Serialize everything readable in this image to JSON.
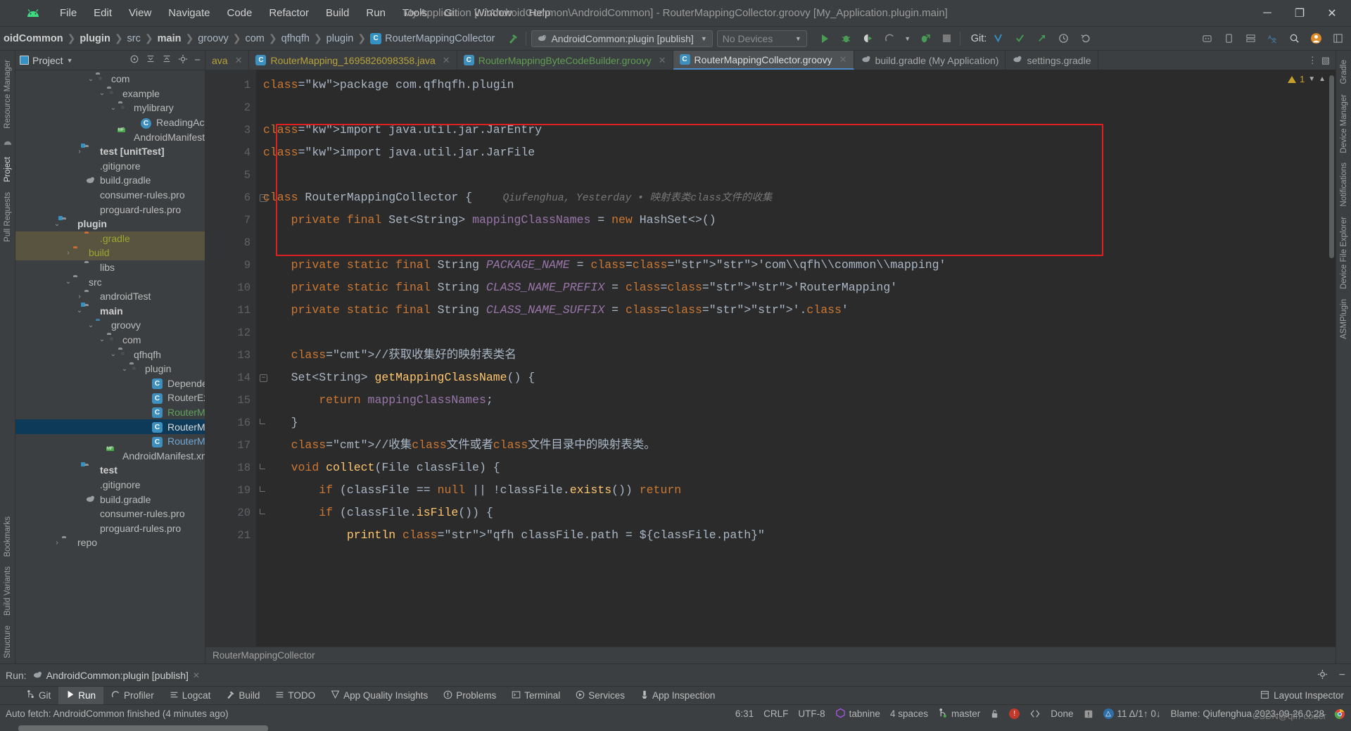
{
  "window": {
    "title": "My Application [...\\AndroidCommon\\AndroidCommon] - RouterMappingCollector.groovy [My_Application.plugin.main]",
    "minimize": "─",
    "maximize": "❐",
    "close": "✕"
  },
  "menu": [
    "File",
    "Edit",
    "View",
    "Navigate",
    "Code",
    "Refactor",
    "Build",
    "Run",
    "Tools",
    "Git",
    "Window",
    "Help"
  ],
  "breadcrumbs": [
    {
      "label": "oidCommon",
      "bold": true,
      "icon": null
    },
    {
      "label": "plugin",
      "bold": true,
      "icon": null
    },
    {
      "label": "src",
      "bold": false,
      "icon": null
    },
    {
      "label": "main",
      "bold": true,
      "icon": null
    },
    {
      "label": "groovy",
      "bold": false,
      "icon": null
    },
    {
      "label": "com",
      "bold": false,
      "icon": null
    },
    {
      "label": "qfhqfh",
      "bold": false,
      "icon": null
    },
    {
      "label": "plugin",
      "bold": false,
      "icon": null
    },
    {
      "label": "RouterMappingCollector",
      "bold": false,
      "icon": "C"
    }
  ],
  "toolbar": {
    "run_config": "AndroidCommon:plugin [publish]",
    "device": "No Devices",
    "git_label": "Git:",
    "icons": [
      "build-hammer-icon",
      "run-icon",
      "debug-icon",
      "run-coverage-icon",
      "profiler-icon",
      "attach-debugger-icon",
      "stop-icon",
      "git-update-icon",
      "git-commit-icon",
      "git-push-icon",
      "history-icon",
      "undo-icon"
    ],
    "right_icons": [
      "search-everywhere-icon",
      "settings-icon",
      "layout-icon",
      "translate-icon",
      "avatar-icon"
    ]
  },
  "project_panel": {
    "title": "Project",
    "header_icons": [
      "target-icon",
      "collapse-all-icon",
      "expand-all-icon",
      "gear-icon",
      "hide-icon"
    ],
    "tree": [
      {
        "label": "com",
        "indent": 6,
        "arrow": "down",
        "icon": "folder-pkg",
        "style": ""
      },
      {
        "label": "example",
        "indent": 7,
        "arrow": "down",
        "icon": "folder-pkg",
        "style": ""
      },
      {
        "label": "mylibrary",
        "indent": 8,
        "arrow": "down",
        "icon": "folder-pkg",
        "style": ""
      },
      {
        "label": "ReadingActiv",
        "indent": 10,
        "arrow": "",
        "icon": "kotlin-class",
        "style": ""
      },
      {
        "label": "AndroidManifest.xml",
        "indent": 8,
        "arrow": "",
        "icon": "manifest",
        "style": ""
      },
      {
        "label": "test [unitTest]",
        "indent": 5,
        "arrow": "right",
        "icon": "folder-src",
        "style": "bold"
      },
      {
        "label": ".gitignore",
        "indent": 5,
        "arrow": "",
        "icon": "gitignore",
        "style": ""
      },
      {
        "label": "build.gradle",
        "indent": 5,
        "arrow": "",
        "icon": "gradle",
        "style": ""
      },
      {
        "label": "consumer-rules.pro",
        "indent": 5,
        "arrow": "",
        "icon": "file",
        "style": ""
      },
      {
        "label": "proguard-rules.pro",
        "indent": 5,
        "arrow": "",
        "icon": "file",
        "style": ""
      },
      {
        "label": "plugin",
        "indent": 3,
        "arrow": "down",
        "icon": "folder-src",
        "style": "bold"
      },
      {
        "label": ".gradle",
        "indent": 5,
        "arrow": "",
        "icon": "folder-orange",
        "style": "olive",
        "highlight": "tan"
      },
      {
        "label": "build",
        "indent": 4,
        "arrow": "right",
        "icon": "folder-orange",
        "style": "olive",
        "highlight": "tan"
      },
      {
        "label": "libs",
        "indent": 5,
        "arrow": "",
        "icon": "folder",
        "style": ""
      },
      {
        "label": "src",
        "indent": 4,
        "arrow": "down",
        "icon": "folder",
        "style": ""
      },
      {
        "label": "androidTest",
        "indent": 5,
        "arrow": "right",
        "icon": "folder",
        "style": ""
      },
      {
        "label": "main",
        "indent": 5,
        "arrow": "down",
        "icon": "folder-src",
        "style": "bold"
      },
      {
        "label": "groovy",
        "indent": 6,
        "arrow": "down",
        "icon": "folder-blue",
        "style": ""
      },
      {
        "label": "com",
        "indent": 7,
        "arrow": "down",
        "icon": "folder-pkg",
        "style": ""
      },
      {
        "label": "qfhqfh",
        "indent": 8,
        "arrow": "down",
        "icon": "folder-pkg",
        "style": ""
      },
      {
        "label": "plugin",
        "indent": 9,
        "arrow": "down",
        "icon": "folder-pkg",
        "style": ""
      },
      {
        "label": "Dependencie",
        "indent": 11,
        "arrow": "",
        "icon": "class",
        "style": ""
      },
      {
        "label": "RouterExtens",
        "indent": 11,
        "arrow": "",
        "icon": "class",
        "style": ""
      },
      {
        "label": "RouterMappi",
        "indent": 11,
        "arrow": "",
        "icon": "class",
        "style": "green"
      },
      {
        "label": "RouterMapp",
        "indent": 11,
        "arrow": "",
        "icon": "class",
        "style": "white",
        "highlight": "sel"
      },
      {
        "label": "RouterMappi",
        "indent": 11,
        "arrow": "",
        "icon": "class",
        "style": "blue"
      },
      {
        "label": "AndroidManifest.xml",
        "indent": 7,
        "arrow": "",
        "icon": "manifest",
        "style": ""
      },
      {
        "label": "test",
        "indent": 5,
        "arrow": "",
        "icon": "folder-src",
        "style": "bold"
      },
      {
        "label": ".gitignore",
        "indent": 5,
        "arrow": "",
        "icon": "gitignore",
        "style": ""
      },
      {
        "label": "build.gradle",
        "indent": 5,
        "arrow": "",
        "icon": "gradle",
        "style": ""
      },
      {
        "label": "consumer-rules.pro",
        "indent": 5,
        "arrow": "",
        "icon": "file",
        "style": ""
      },
      {
        "label": "proguard-rules.pro",
        "indent": 5,
        "arrow": "",
        "icon": "file",
        "style": ""
      },
      {
        "label": "repo",
        "indent": 3,
        "arrow": "right",
        "icon": "folder",
        "style": ""
      }
    ]
  },
  "left_strip": [
    "Resource Manager",
    "Project",
    "Pull Requests"
  ],
  "left_strip_bottom": [
    "Bookmarks",
    "Build Variants",
    "Structure"
  ],
  "right_strip": [
    "Gradle",
    "Device Manager",
    "Notifications",
    "Device File Explorer",
    "ASMPlugin"
  ],
  "editor_tabs": [
    {
      "label": "ava",
      "icon": "",
      "color": "yellow",
      "active": false,
      "closable": true
    },
    {
      "label": "RouterMapping_1695826098358.java",
      "icon": "C",
      "color": "yellow",
      "active": false,
      "closable": true
    },
    {
      "label": "RouterMappingByteCodeBuilder.groovy",
      "icon": "C",
      "color": "green",
      "active": false,
      "closable": true
    },
    {
      "label": "RouterMappingCollector.groovy",
      "icon": "C",
      "color": "white",
      "active": true,
      "closable": true
    },
    {
      "label": "build.gradle (My Application)",
      "icon": "gradle",
      "color": "white",
      "active": false,
      "closable": false
    },
    {
      "label": "settings.gradle",
      "icon": "gradle",
      "color": "white",
      "active": false,
      "closable": false
    }
  ],
  "editor": {
    "warning_count": "1",
    "line_numbers": [
      "1",
      "2",
      "3",
      "4",
      "5",
      "6",
      "7",
      "8",
      "9",
      "10",
      "11",
      "12",
      "13",
      "14",
      "15",
      "16",
      "17",
      "18",
      "19",
      "20",
      "21"
    ],
    "inlay_hint": "Qiufenghua, Yesterday • 映射表类class文件的收集",
    "lines": [
      "package com.qfhqfh.plugin",
      "",
      "import java.util.jar.JarEntry",
      "import java.util.jar.JarFile",
      "",
      "class RouterMappingCollector {",
      "    private final Set<String> mappingClassNames = new HashSet<>()",
      "",
      "    private static final String PACKAGE_NAME = 'com\\\\qfh\\\\common\\\\mapping'",
      "    private static final String CLASS_NAME_PREFIX = 'RouterMapping'",
      "    private static final String CLASS_NAME_SUFFIX = '.class'",
      "",
      "    //获取收集好的映射表类名",
      "    Set<String> getMappingClassName() {",
      "        return mappingClassNames;",
      "    }",
      "    //收集class文件或者class文件目录中的映射表类。",
      "    void collect(File classFile) {",
      "        if (classFile == null || !classFile.exists()) return",
      "        if (classFile.isFile()) {",
      "            println \"qfh classFile.path = ${classFile.path}\""
    ],
    "breadcrumb_bottom": "RouterMappingCollector",
    "highlight_color": "#e02020"
  },
  "run_panel": {
    "label": "Run:",
    "tab": "AndroidCommon:plugin [publish]",
    "close": "✕",
    "right_icons": [
      "settings-icon",
      "minimize-icon"
    ]
  },
  "bottom_toolwindows": [
    {
      "label": "Git",
      "icon": "git-icon",
      "active": false
    },
    {
      "label": "Run",
      "icon": "run-icon",
      "active": true
    },
    {
      "label": "Profiler",
      "icon": "profiler-icon",
      "active": false
    },
    {
      "label": "Logcat",
      "icon": "logcat-icon",
      "active": false
    },
    {
      "label": "Build",
      "icon": "build-icon",
      "active": false
    },
    {
      "label": "TODO",
      "icon": "todo-icon",
      "active": false
    },
    {
      "label": "App Quality Insights",
      "icon": "insights-icon",
      "active": false
    },
    {
      "label": "Problems",
      "icon": "problems-icon",
      "active": false
    },
    {
      "label": "Terminal",
      "icon": "terminal-icon",
      "active": false
    },
    {
      "label": "Services",
      "icon": "services-icon",
      "active": false
    },
    {
      "label": "App Inspection",
      "icon": "inspection-icon",
      "active": false
    }
  ],
  "bottom_right": {
    "label": "Layout Inspector",
    "icon": "layout-inspector-icon"
  },
  "status_bar": {
    "message": "Auto fetch: AndroidCommon finished (4 minutes ago)",
    "position": "6:31",
    "line_separator": "CRLF",
    "encoding": "UTF-8",
    "plugin": "tabnine",
    "indent": "4 spaces",
    "branch": "master",
    "done": "Done",
    "diff_stats": "11 Δ/1↑ 0↓",
    "blame": "Blame: Qiufenghua 2023-09-26 0:28",
    "watermark": "CSDN@qfh-coder",
    "icons": [
      "lock-icon",
      "error-icon",
      "inspection-icon",
      "notification-icon",
      "analyze-icon",
      "chrome-icon"
    ]
  },
  "colors": {
    "accent": "#3592c4",
    "background": "#3c3f41",
    "editor_bg": "#2b2b2b",
    "selection": "#0d3a58",
    "highlight_tan": "#58543f",
    "red_box": "#e02020",
    "green": "#499c54",
    "keyword": "#cc7832",
    "string": "#6a8759",
    "comment": "#808080",
    "field": "#9876aa"
  }
}
